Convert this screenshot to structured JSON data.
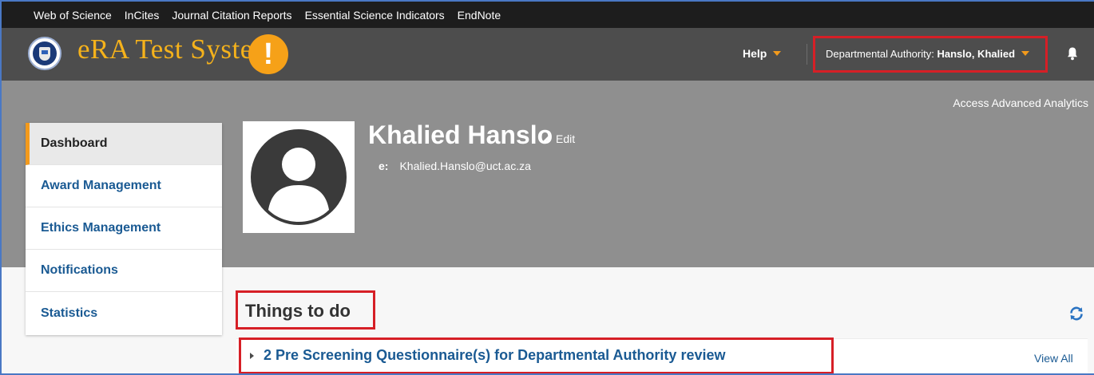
{
  "top_links": [
    "Web of Science",
    "InCites",
    "Journal Citation Reports",
    "Essential Science Indicators",
    "EndNote"
  ],
  "header": {
    "app_title": "eRA Test System",
    "warning_glyph": "!",
    "help_label": "Help",
    "role_prefix": "Departmental Authority:",
    "role_user": "Hanslo, Khalied",
    "logo_icon": "university-shield-icon",
    "bell_icon": "bell-icon"
  },
  "profile": {
    "access_analytics": "Access Advanced Analytics",
    "name": "Khalied Hanslo",
    "edit_label": "Edit",
    "email_label": "e:",
    "email": "Khalied.Hanslo@uct.ac.za",
    "avatar_icon": "user-avatar-icon"
  },
  "sidebar": {
    "items": [
      {
        "label": "Dashboard",
        "active": true
      },
      {
        "label": "Award Management",
        "active": false
      },
      {
        "label": "Ethics Management",
        "active": false
      },
      {
        "label": "Notifications",
        "active": false
      },
      {
        "label": "Statistics",
        "active": false
      }
    ]
  },
  "main": {
    "section_title": "Things to do",
    "refresh_icon": "refresh-icon",
    "tasks": [
      {
        "label": "2 Pre Screening Questionnaire(s) for Departmental Authority review",
        "view_all": "View All"
      }
    ]
  },
  "colors": {
    "accent_orange": "#f39a1c",
    "title_gold": "#f5b21b",
    "link_blue": "#1a5a93",
    "highlight_red": "#d61f26",
    "header_grey": "#4d4d4d",
    "band_grey": "#8f8f8f"
  }
}
